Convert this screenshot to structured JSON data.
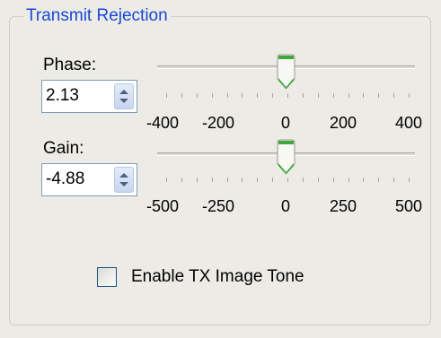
{
  "group": {
    "title": "Transmit Rejection"
  },
  "phase": {
    "label": "Phase:",
    "value": "2.13",
    "slider_fraction": 0.5,
    "ticks": [
      "-400",
      "-200",
      "0",
      "200",
      "400"
    ]
  },
  "gain": {
    "label": "Gain:",
    "value": "-4.88",
    "slider_fraction": 0.5,
    "ticks": [
      "-500",
      "-250",
      "0",
      "250",
      "500"
    ]
  },
  "tx_tone": {
    "label": "Enable TX Image Tone",
    "checked": false
  },
  "colors": {
    "title": "#1a48d6",
    "thumb_green": "#3fa83a",
    "background": "#ecebe5"
  },
  "icons": {
    "spin": "spin-arrows-icon",
    "thumb": "slider-thumb-icon"
  }
}
